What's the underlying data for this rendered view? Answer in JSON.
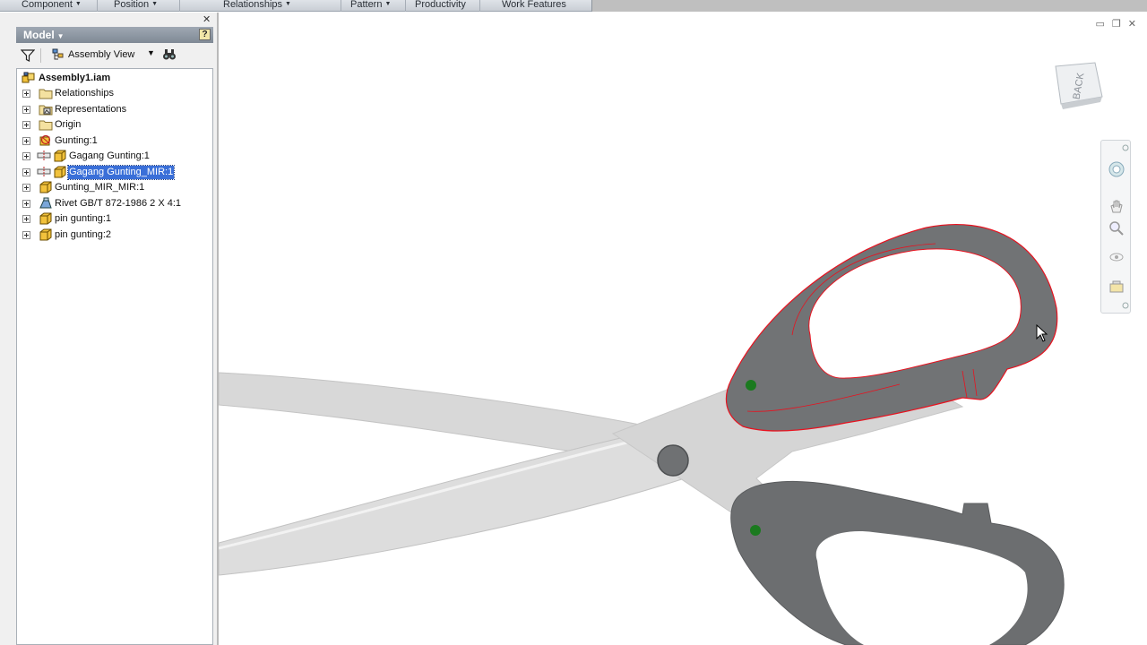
{
  "ribbon": {
    "tabs": [
      {
        "label": "Component",
        "dropdown": true
      },
      {
        "label": "Position",
        "dropdown": true
      },
      {
        "label": "Relationships",
        "dropdown": true
      },
      {
        "label": "Pattern",
        "dropdown": true
      },
      {
        "label": "Productivity",
        "dropdown": false
      },
      {
        "label": "Work Features",
        "dropdown": false
      }
    ]
  },
  "browser": {
    "title": "Model",
    "view_label": "Assembly View",
    "tree": [
      {
        "label": "Assembly1.iam",
        "icon": "assembly-icon",
        "root": true
      },
      {
        "label": "Relationships",
        "icon": "folder-icon"
      },
      {
        "label": "Representations",
        "icon": "representations-icon"
      },
      {
        "label": "Origin",
        "icon": "folder-icon"
      },
      {
        "label": "Gunting:1",
        "icon": "constrained-assembly-icon"
      },
      {
        "label": "Gagang Gunting:1",
        "icon": "part-icon",
        "mirrored": true
      },
      {
        "label": "Gagang Gunting_MIR:1",
        "icon": "part-icon",
        "mirrored": true,
        "selected": true
      },
      {
        "label": "Gunting_MIR_MIR:1",
        "icon": "part-icon"
      },
      {
        "label": "Rivet GB/T 872-1986 2 X 4:1",
        "icon": "content-center-part-icon"
      },
      {
        "label": "pin gunting:1",
        "icon": "part-icon"
      },
      {
        "label": "pin gunting:2",
        "icon": "part-icon"
      }
    ]
  },
  "viewport": {
    "viewcube_face": "BACK"
  },
  "colors": {
    "selection": "#3a6fd8",
    "handle": "#6e6f71",
    "blade": "#d4d4d4",
    "highlight_edges": "#e8121f",
    "constraint_dot": "#1b7a1f"
  }
}
